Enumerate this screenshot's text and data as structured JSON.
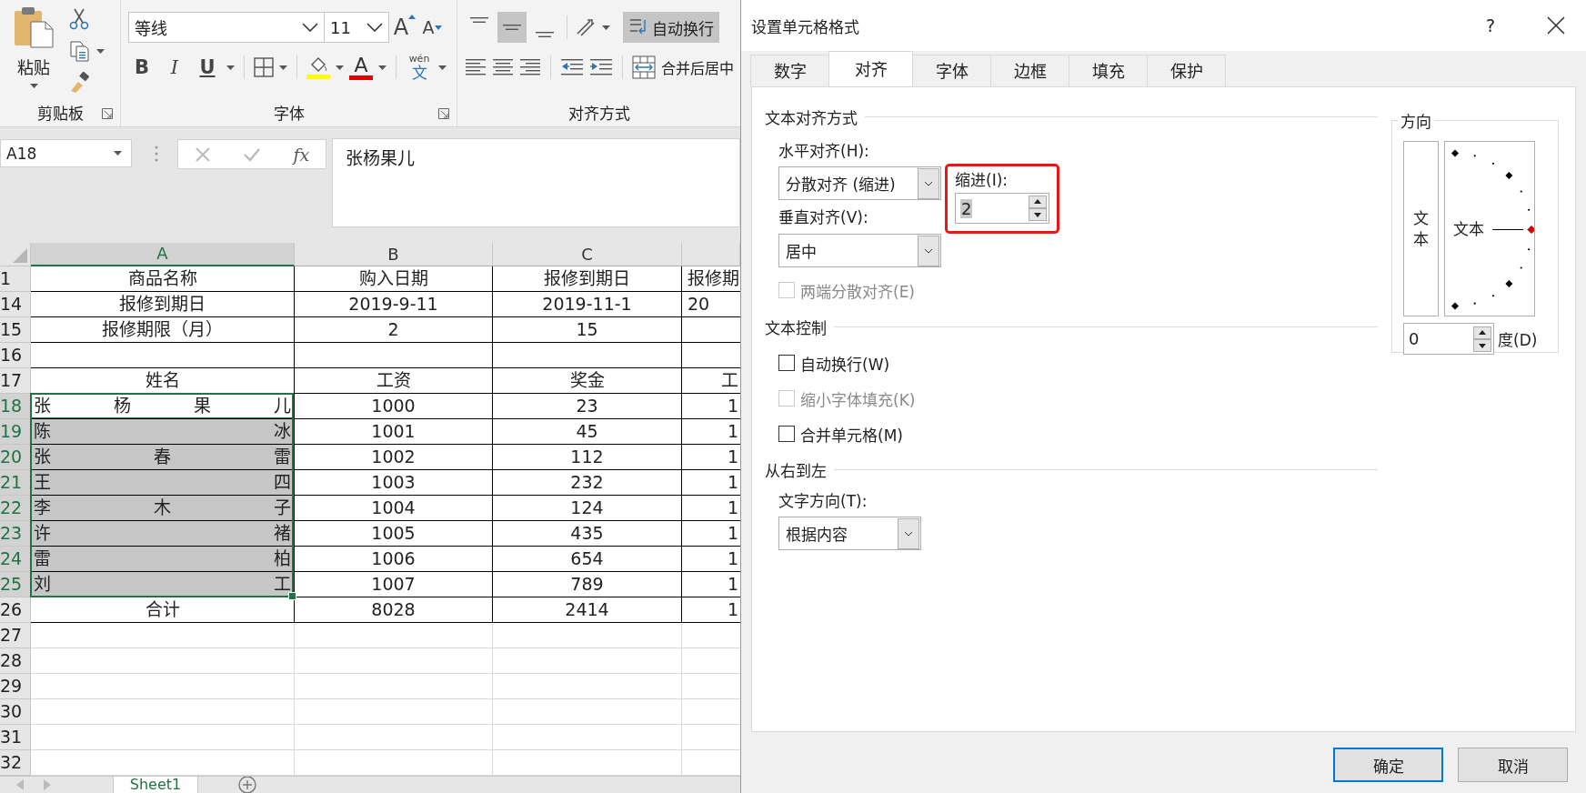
{
  "ribbon": {
    "clipboard": {
      "paste_label": "粘贴",
      "group_label": "剪贴板"
    },
    "font": {
      "font_name": "等线",
      "font_size": "11",
      "grow": "A",
      "shrink": "A",
      "bold": "B",
      "italic": "I",
      "underline": "U",
      "font_color": "A",
      "phonetic_ruby": "wén",
      "phonetic": "文",
      "group_label": "字体"
    },
    "alignment": {
      "vertical_align": [
        {
          "kind": "top",
          "selected": false
        },
        {
          "kind": "middle",
          "selected": true
        },
        {
          "kind": "bottom",
          "selected": false
        }
      ],
      "wrap_text": {
        "label": "自动换行",
        "highlighted": true
      },
      "merge": {
        "label": "合并后居中"
      },
      "group_label": "对齐方式"
    }
  },
  "formula_bar": {
    "name_box": "A18",
    "function_label": "fx",
    "content": "张杨果儿"
  },
  "sheet": {
    "columns": [
      {
        "label": "A",
        "selected": true
      },
      {
        "label": "B",
        "selected": false
      },
      {
        "label": "C",
        "selected": false
      },
      {
        "selected": false
      }
    ],
    "rows": [
      {
        "header": "1",
        "kind": "plain",
        "selected": false,
        "active": false,
        "bordered": true,
        "cells": [
          "商品名称",
          "购入日期",
          "报修到期日",
          "报修期"
        ]
      },
      {
        "header": "14",
        "kind": "plain",
        "selected": false,
        "active": false,
        "bordered": true,
        "cells": [
          "报修到期日",
          "2019-9-11",
          "2019-11-1",
          "20"
        ]
      },
      {
        "header": "15",
        "kind": "plain",
        "selected": false,
        "active": false,
        "bordered": true,
        "cells": [
          "报修期限（月）",
          "2",
          "15"
        ]
      },
      {
        "header": "16",
        "kind": "plain",
        "selected": false,
        "active": false,
        "bordered": true
      },
      {
        "header": "17",
        "kind": "plain",
        "selected": false,
        "active": false,
        "bordered": true,
        "cells": [
          "姓名",
          "工资",
          "奖金",
          "工"
        ]
      },
      {
        "header": "18",
        "kind": "distributed",
        "selected": true,
        "active": true,
        "bordered": true,
        "cells": [
          "张杨果儿",
          "1000",
          "23",
          "1"
        ]
      },
      {
        "header": "19",
        "kind": "distributed",
        "selected": true,
        "active": false,
        "bordered": true,
        "cells": [
          "陈冰",
          "1001",
          "45",
          "1"
        ]
      },
      {
        "header": "20",
        "kind": "distributed",
        "selected": true,
        "active": false,
        "bordered": true,
        "cells": [
          "张春雷",
          "1002",
          "112",
          "1"
        ]
      },
      {
        "header": "21",
        "kind": "distributed",
        "selected": true,
        "active": false,
        "bordered": true,
        "cells": [
          "王四",
          "1003",
          "232",
          "1"
        ]
      },
      {
        "header": "22",
        "kind": "distributed",
        "selected": true,
        "active": false,
        "bordered": true,
        "cells": [
          "李木子",
          "1004",
          "124",
          "1"
        ]
      },
      {
        "header": "23",
        "kind": "distributed",
        "selected": true,
        "active": false,
        "bordered": true,
        "cells": [
          "许褚",
          "1005",
          "435",
          "1"
        ]
      },
      {
        "header": "24",
        "kind": "distributed",
        "selected": true,
        "active": false,
        "bordered": true,
        "cells": [
          "雷柏",
          "1006",
          "654",
          "1"
        ]
      },
      {
        "header": "25",
        "kind": "distributed",
        "selected": true,
        "active": false,
        "bordered": true,
        "cells": [
          "刘工",
          "1007",
          "789",
          "1"
        ]
      },
      {
        "header": "26",
        "kind": "plain",
        "selected": false,
        "active": false,
        "bordered": true,
        "cells": [
          "合计",
          "8028",
          "2414",
          "1"
        ]
      },
      {
        "header": "27",
        "kind": "plain",
        "selected": false,
        "active": false,
        "bordered": false
      },
      {
        "header": "28",
        "kind": "plain",
        "selected": false,
        "active": false,
        "bordered": false
      },
      {
        "header": "29",
        "kind": "plain",
        "selected": false,
        "active": false,
        "bordered": false
      },
      {
        "header": "30",
        "kind": "plain",
        "selected": false,
        "active": false,
        "bordered": false
      },
      {
        "header": "31",
        "kind": "plain",
        "selected": false,
        "active": false,
        "bordered": false
      },
      {
        "header": "32",
        "kind": "plain",
        "selected": false,
        "active": false,
        "bordered": false
      }
    ]
  },
  "sheet_tabs": [
    {
      "label": "Sheet1",
      "selected": true
    }
  ],
  "dialog": {
    "title": "设置单元格格式",
    "help": "?",
    "tabs": [
      {
        "label": "数字",
        "selected": false
      },
      {
        "label": "对齐",
        "selected": true
      },
      {
        "label": "字体",
        "selected": false
      },
      {
        "label": "边框",
        "selected": false
      },
      {
        "label": "填充",
        "selected": false
      },
      {
        "label": "保护",
        "selected": false
      }
    ],
    "text_alignment": {
      "title": "文本对齐方式",
      "horizontal_label": "水平对齐(H):",
      "horizontal_value": "分散对齐 (缩进)",
      "vertical_label": "垂直对齐(V):",
      "vertical_value": "居中",
      "indent_label": "缩进(I):",
      "indent_value": "2",
      "indent_value_highlighted": true,
      "indent_highlighted": true,
      "justify_distributed": {
        "label": "两端分散对齐(E)",
        "checked": false,
        "disabled": true
      }
    },
    "text_control": {
      "title": "文本控制",
      "options": [
        {
          "label": "自动换行(W)",
          "checked": false,
          "disabled": false
        },
        {
          "label": "缩小字体填充(K)",
          "checked": false,
          "disabled": true
        },
        {
          "label": "合并单元格(M)",
          "checked": false,
          "disabled": false
        }
      ]
    },
    "rtl": {
      "title": "从右到左",
      "direction_label": "文字方向(T):",
      "direction_value": "根据内容"
    },
    "orientation": {
      "title": "方向",
      "vertical_text": "文本",
      "dial_text": "文本",
      "degrees": "0",
      "degrees_label": "度(D)"
    },
    "buttons": [
      {
        "label": "确定",
        "default": true
      },
      {
        "label": "取消",
        "default": false
      }
    ]
  }
}
